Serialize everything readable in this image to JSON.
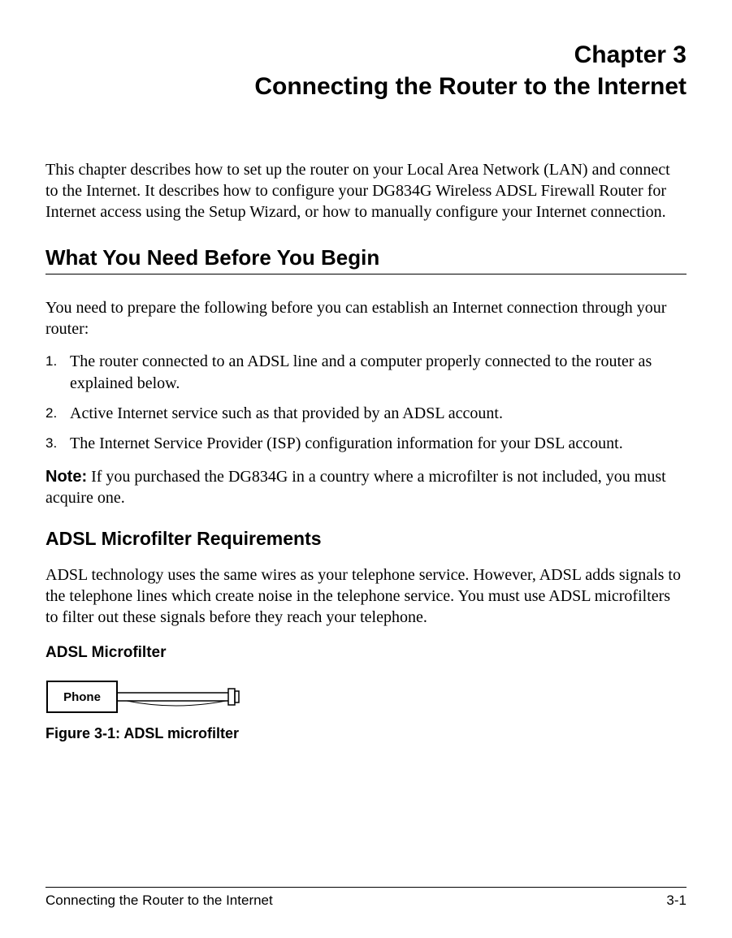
{
  "chapter": {
    "number": "Chapter 3",
    "title": "Connecting the Router to the Internet"
  },
  "intro": "This chapter describes how to set up the router on your Local Area Network (LAN) and connect to the Internet. It describes how to configure your DG834G Wireless ADSL Firewall Router for Internet access using the Setup Wizard, or how to manually configure your Internet connection.",
  "section1": {
    "heading": "What You Need Before You Begin",
    "lead": "You need to prepare the following before you can establish an Internet connection through your router:",
    "items": [
      {
        "num": "1.",
        "text": "The router connected to an ADSL line and a computer properly connected to the router as explained below."
      },
      {
        "num": "2.",
        "text": "Active Internet service such as that provided by an ADSL account."
      },
      {
        "num": "3.",
        "text": "The Internet Service Provider (ISP) configuration information for your DSL account."
      }
    ],
    "note_label": "Note:",
    "note_text": " If you purchased the DG834G in a country where a microfilter is not included, you must acquire one."
  },
  "section2": {
    "heading": "ADSL Microfilter Requirements",
    "text": "ADSL technology uses the same wires as your telephone service. However, ADSL adds signals to the telephone lines which create noise in the telephone service. You must use ADSL microfilters to filter out these signals before they reach your telephone."
  },
  "section3": {
    "heading": "ADSL Microfilter",
    "figure_label": "Phone",
    "figure_caption": "Figure 3-1:  ADSL microfilter"
  },
  "footer": {
    "left": "Connecting the Router to the Internet",
    "right": "3-1"
  }
}
